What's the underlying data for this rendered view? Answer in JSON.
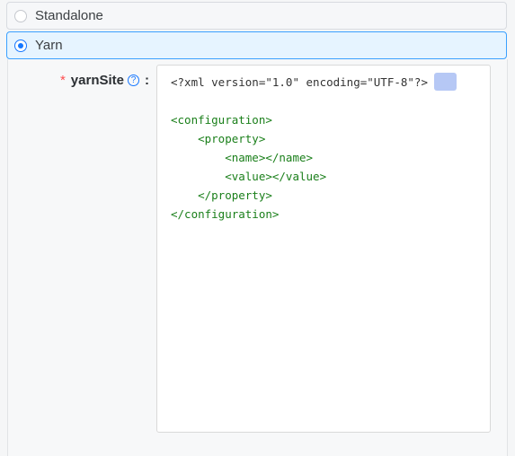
{
  "options": [
    {
      "label": "Standalone",
      "selected": false
    },
    {
      "label": "Yarn",
      "selected": true
    }
  ],
  "field": {
    "required_mark": "*",
    "label": "yarnSite",
    "help_icon": "question-circle-icon",
    "colon": ":"
  },
  "editor": {
    "lines": [
      "<?xml version=\"1.0\" encoding=\"UTF-8\"?>",
      "",
      "<configuration>",
      "    <property>",
      "        <name></name>",
      "        <value></value>",
      "    </property>",
      "</configuration>"
    ]
  },
  "colors": {
    "accent": "#1677ff",
    "required": "#ff4d4f",
    "xml_tag": "#1a7f1a"
  }
}
